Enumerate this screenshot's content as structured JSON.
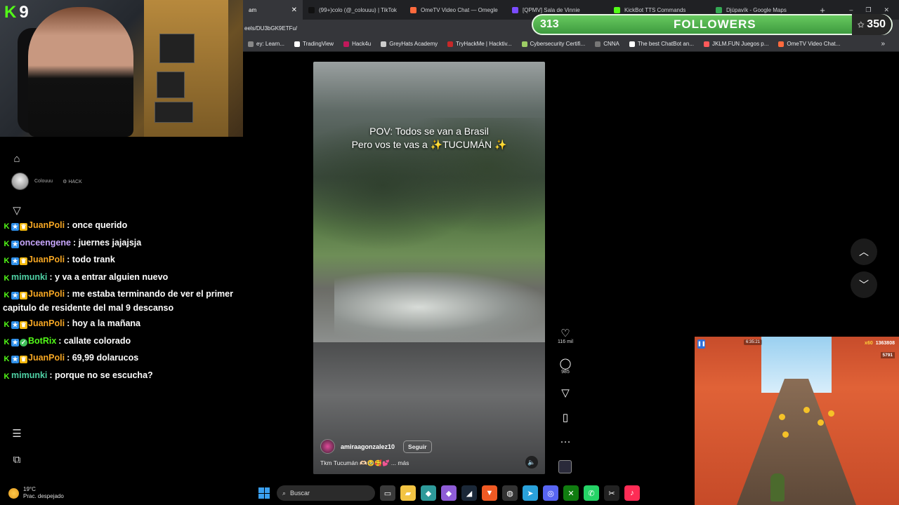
{
  "browser": {
    "tabs": [
      {
        "label": "am",
        "active": true,
        "color": "#e1306c"
      },
      {
        "label": "(99+)colo (@_colouuu) | TikTok",
        "color": "#111111"
      },
      {
        "label": "OmeTV Video Chat — Omegle",
        "color": "#ff6a3d"
      },
      {
        "label": "[QPMV] Sala de Vinnie",
        "color": "#7a4cff"
      },
      {
        "label": "KickBot TTS Commands",
        "color": "#53fc18"
      },
      {
        "label": "Djúpavík - Google Maps",
        "color": "#34a853"
      }
    ],
    "new_tab": "+",
    "url": "eels/DU3bGK9ETFu/",
    "window_controls": [
      "–",
      "❐",
      "✕"
    ]
  },
  "bookmarks": [
    {
      "label": "ey: Learn...",
      "color": "#888888"
    },
    {
      "label": "TradingView",
      "color": "#ffffff"
    },
    {
      "label": "Hack4u",
      "color": "#c2185b"
    },
    {
      "label": "GreyHats Academy",
      "color": "#cccccc"
    },
    {
      "label": "TryHackMe | Hacktiv...",
      "color": "#c62828"
    },
    {
      "label": "Cybersecurity Certifi...",
      "color": "#9ccc65"
    },
    {
      "label": "CNNA",
      "color": "#777777"
    },
    {
      "label": "The best ChatBot an...",
      "color": "#ffffff"
    },
    {
      "label": "JKLM.FUN Juegos p...",
      "color": "#ff5a5a"
    },
    {
      "label": "OmeTV Video Chat...",
      "color": "#ff6a3d"
    }
  ],
  "followers": {
    "count": "313",
    "label": "FOLLOWERS",
    "goal": "350"
  },
  "webcam": {
    "channel_badge": "9"
  },
  "account": {
    "name": "Colouuu",
    "tag": "HACK"
  },
  "chat": [
    {
      "user": "JuanPoli",
      "color": "#f5a623",
      "badges": [
        "k",
        "blue",
        "gold"
      ],
      "text": ": once querido"
    },
    {
      "user": "onceengene",
      "color": "#c9a7ff",
      "badges": [
        "k",
        "blue"
      ],
      "text": ": juernes jajajsja"
    },
    {
      "user": "JuanPoli",
      "color": "#f5a623",
      "badges": [
        "k",
        "blue",
        "gold"
      ],
      "text": ": todo trank"
    },
    {
      "user": "mimunki",
      "color": "#4fd1a5",
      "badges": [
        "k"
      ],
      "text": ": y va a entrar alguien nuevo"
    },
    {
      "user": "JuanPoli",
      "color": "#f5a623",
      "badges": [
        "k",
        "blue",
        "gold"
      ],
      "text": ": me estaba terminando de ver el primer capitulo de residente del mal 9 descanso",
      "wrap": true
    },
    {
      "user": "JuanPoli",
      "color": "#f5a623",
      "badges": [
        "k",
        "blue",
        "gold"
      ],
      "text": ": hoy a la mañana"
    },
    {
      "user": "BotRix",
      "color": "#53fc18",
      "badges": [
        "k",
        "blue",
        "green"
      ],
      "text": ": callate colorado"
    },
    {
      "user": "JuanPoli",
      "color": "#f5a623",
      "badges": [
        "k",
        "blue",
        "gold"
      ],
      "text": ": 69,99 dolarucos"
    },
    {
      "user": "mimunki",
      "color": "#4fd1a5",
      "badges": [
        "k"
      ],
      "text": ": porque no se escucha?"
    }
  ],
  "video": {
    "caption_line1": "POV: Todos se van  a Brasil",
    "caption_line2": "Pero vos te vas a ✨TUCUMÁN ✨",
    "author": "amiraagonzalez10",
    "follow_label": "Seguir",
    "description": "Tkm Tucumán 🫶🏻🥹🥰💕 ... más"
  },
  "actions": {
    "likes": "116 mil",
    "comments": "985"
  },
  "game": {
    "time": "6:35:21",
    "multiplier": "x60",
    "score": "1363808",
    "coins": "5791"
  },
  "taskbar": {
    "temperature": "19°C",
    "condition": "Prac. despejado",
    "search_placeholder": "Buscar",
    "apps": [
      {
        "name": "task-view",
        "glyph": "▭",
        "color": "#3a3a3a"
      },
      {
        "name": "files",
        "glyph": "▰",
        "color": "#f3c443"
      },
      {
        "name": "visual-studio",
        "glyph": "◆",
        "color": "#2e9a9a"
      },
      {
        "name": "obs",
        "glyph": "◆",
        "color": "#8e5cd6"
      },
      {
        "name": "steam",
        "glyph": "◢",
        "color": "#1b2838"
      },
      {
        "name": "brave",
        "glyph": "▼",
        "color": "#f05a24"
      },
      {
        "name": "github",
        "glyph": "◍",
        "color": "#333333"
      },
      {
        "name": "telegram",
        "glyph": "➤",
        "color": "#2aa1da"
      },
      {
        "name": "discord",
        "glyph": "◎",
        "color": "#5865f2"
      },
      {
        "name": "xbox",
        "glyph": "✕",
        "color": "#107c10"
      },
      {
        "name": "whatsapp",
        "glyph": "✆",
        "color": "#25d366"
      },
      {
        "name": "capcut",
        "glyph": "✂",
        "color": "#222222"
      },
      {
        "name": "tiktok",
        "glyph": "♪",
        "color": "#fe2c55"
      }
    ]
  }
}
